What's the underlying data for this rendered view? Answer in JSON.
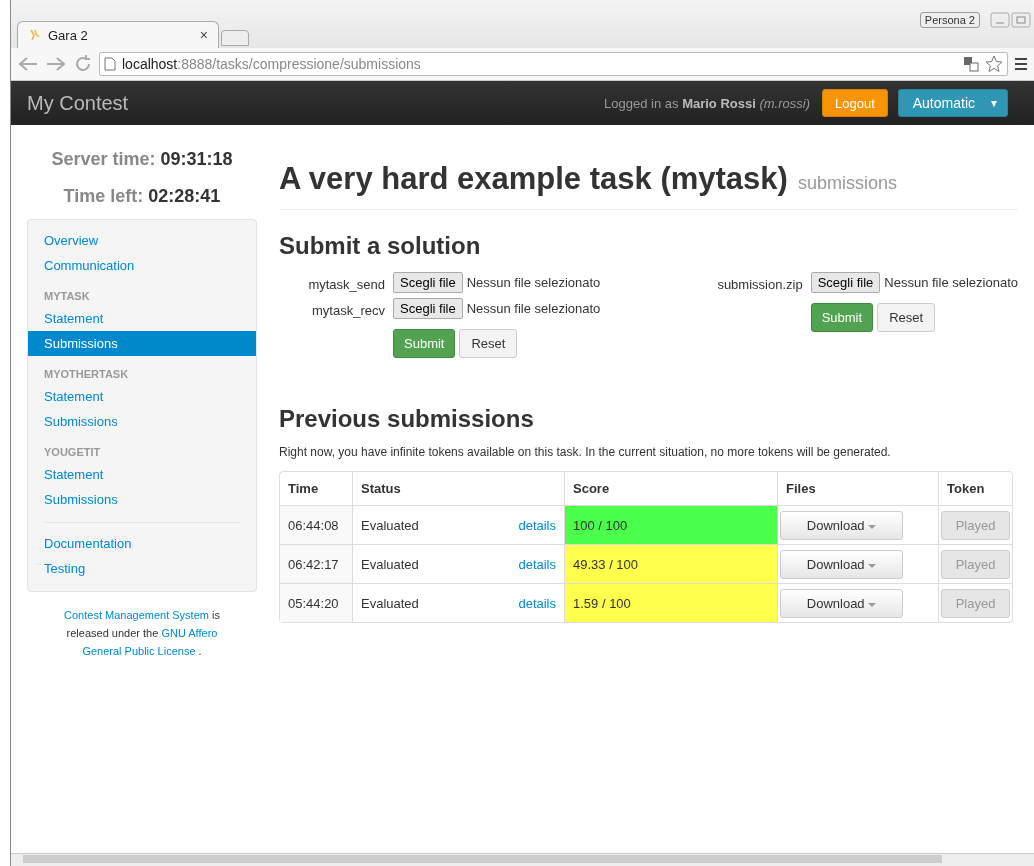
{
  "browser": {
    "tab_title": "Gara 2",
    "tab_close": "×",
    "profile": "Persona 2",
    "url": "**localhost**:8888/tasks/compressione/submissions"
  },
  "navbar": {
    "brand": "My Contest",
    "logged_in_prefix": "Logged in as",
    "user_name": "Mario Rossi",
    "username": "(m.rossi)",
    "logout": "Logout",
    "language": "Automatic",
    "language_caret": "▾"
  },
  "sidebar": {
    "server_time_label": "Server time:",
    "server_time": "09:31:18",
    "time_left_label": "Time left:",
    "time_left": "02:28:41",
    "groups": [
      {
        "items": [
          {
            "label": "Overview",
            "selected": false
          },
          {
            "label": "Communication",
            "selected": false
          }
        ]
      },
      {
        "header": "MYTASK",
        "items": [
          {
            "label": "Statement",
            "selected": false
          },
          {
            "label": "Submissions",
            "selected": true
          }
        ]
      },
      {
        "header": "MYOTHERTASK",
        "items": [
          {
            "label": "Statement",
            "selected": false
          },
          {
            "label": "Submissions",
            "selected": false
          }
        ]
      },
      {
        "header": "YOUGETIT",
        "items": [
          {
            "label": "Statement",
            "selected": false
          },
          {
            "label": "Submissions",
            "selected": false
          }
        ]
      },
      {
        "divider": true,
        "items": [
          {
            "label": "Documentation",
            "selected": false
          },
          {
            "label": "Testing",
            "selected": false
          }
        ]
      }
    ],
    "footer": {
      "link1": "Contest Management System",
      "text1": "is released under the",
      "link2": "GNU Affero",
      "link3": "General Public License",
      "text2": "."
    }
  },
  "page": {
    "title": "A very hard example task (mytask)",
    "subtitle": "submissions",
    "submit_heading": "Submit a solution",
    "forms": [
      {
        "fields": [
          {
            "label": "mytask_send",
            "button": "Scegli file",
            "status": "Nessun file selezionato"
          },
          {
            "label": "mytask_recv",
            "button": "Scegli file",
            "status": "Nessun file selezionato"
          }
        ],
        "submit": "Submit",
        "reset": "Reset"
      },
      {
        "fields": [
          {
            "label": "submission.zip",
            "button": "Scegli file",
            "status": "Nessun file selezionato"
          }
        ],
        "submit": "Submit",
        "reset": "Reset"
      }
    ],
    "previous_heading": "Previous submissions",
    "tokens_note": "Right now, you have infinite tokens available on this task. In the current situation, no more tokens will be generated.",
    "table": {
      "columns": [
        "Time",
        "Status",
        "Score",
        "Files",
        "Token"
      ],
      "rows": [
        {
          "time": "06:44:08",
          "status": "Evaluated",
          "details": "details",
          "score": "100 / 100",
          "color": "#4cff4c",
          "files": "Download",
          "token": "Played",
          "token_disabled": true
        },
        {
          "time": "06:42:17",
          "status": "Evaluated",
          "details": "details",
          "score": "49.33 / 100",
          "color": "#ffff4c",
          "files": "Download",
          "token": "Played",
          "token_disabled": true
        },
        {
          "time": "05:44:20",
          "status": "Evaluated",
          "details": "details",
          "score": "1.59 / 100",
          "color": "#ffff4c",
          "files": "Download",
          "token": "Played",
          "token_disabled": true
        }
      ]
    }
  }
}
